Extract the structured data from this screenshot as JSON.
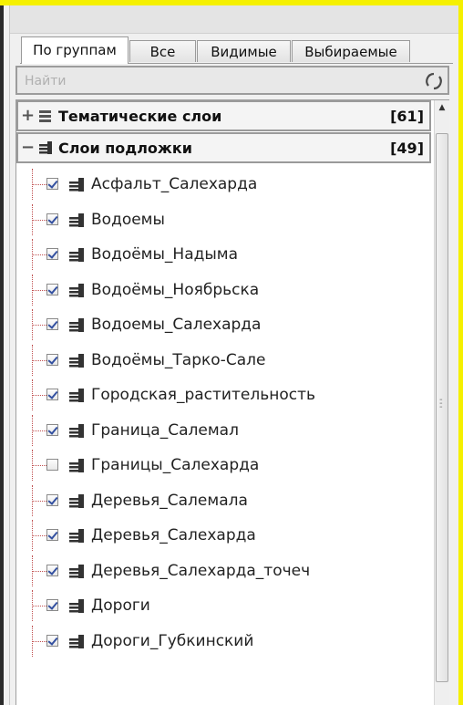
{
  "tabs": [
    {
      "label": "По группам",
      "active": true
    },
    {
      "label": "Все",
      "active": false
    },
    {
      "label": "Видимые",
      "active": false
    },
    {
      "label": "Выбираемые",
      "active": false
    }
  ],
  "search": {
    "placeholder": "Найти",
    "refresh_icon": "refresh-icon"
  },
  "groups": [
    {
      "name": "Тематические слои",
      "count": "[61]",
      "state": "collapsed",
      "icon": "layers-icon"
    },
    {
      "name": "Слои подложки",
      "count": "[49]",
      "state": "expanded",
      "icon": "layers-icon"
    }
  ],
  "layers": [
    {
      "name": "Асфальт_Салехарда",
      "checked": true
    },
    {
      "name": "Водоемы",
      "checked": true
    },
    {
      "name": "Водоёмы_Надыма",
      "checked": true
    },
    {
      "name": "Водоёмы_Ноябрьска",
      "checked": true
    },
    {
      "name": "Водоемы_Салехарда",
      "checked": true
    },
    {
      "name": "Водоёмы_Тарко-Сале",
      "checked": true
    },
    {
      "name": "Городская_растительность",
      "checked": true
    },
    {
      "name": "Граница_Салемал",
      "checked": true
    },
    {
      "name": "Границы_Салехарда",
      "checked": false
    },
    {
      "name": "Деревья_Салемала",
      "checked": true
    },
    {
      "name": "Деревья_Салехарда",
      "checked": true
    },
    {
      "name": "Деревья_Салехарда_точеч",
      "checked": true
    },
    {
      "name": "Дороги",
      "checked": true
    },
    {
      "name": "Дороги_Губкинский",
      "checked": true
    }
  ],
  "colors": {
    "frame": "#f5f000",
    "tree_line": "#c05050",
    "checkmark": "#3350a0"
  }
}
